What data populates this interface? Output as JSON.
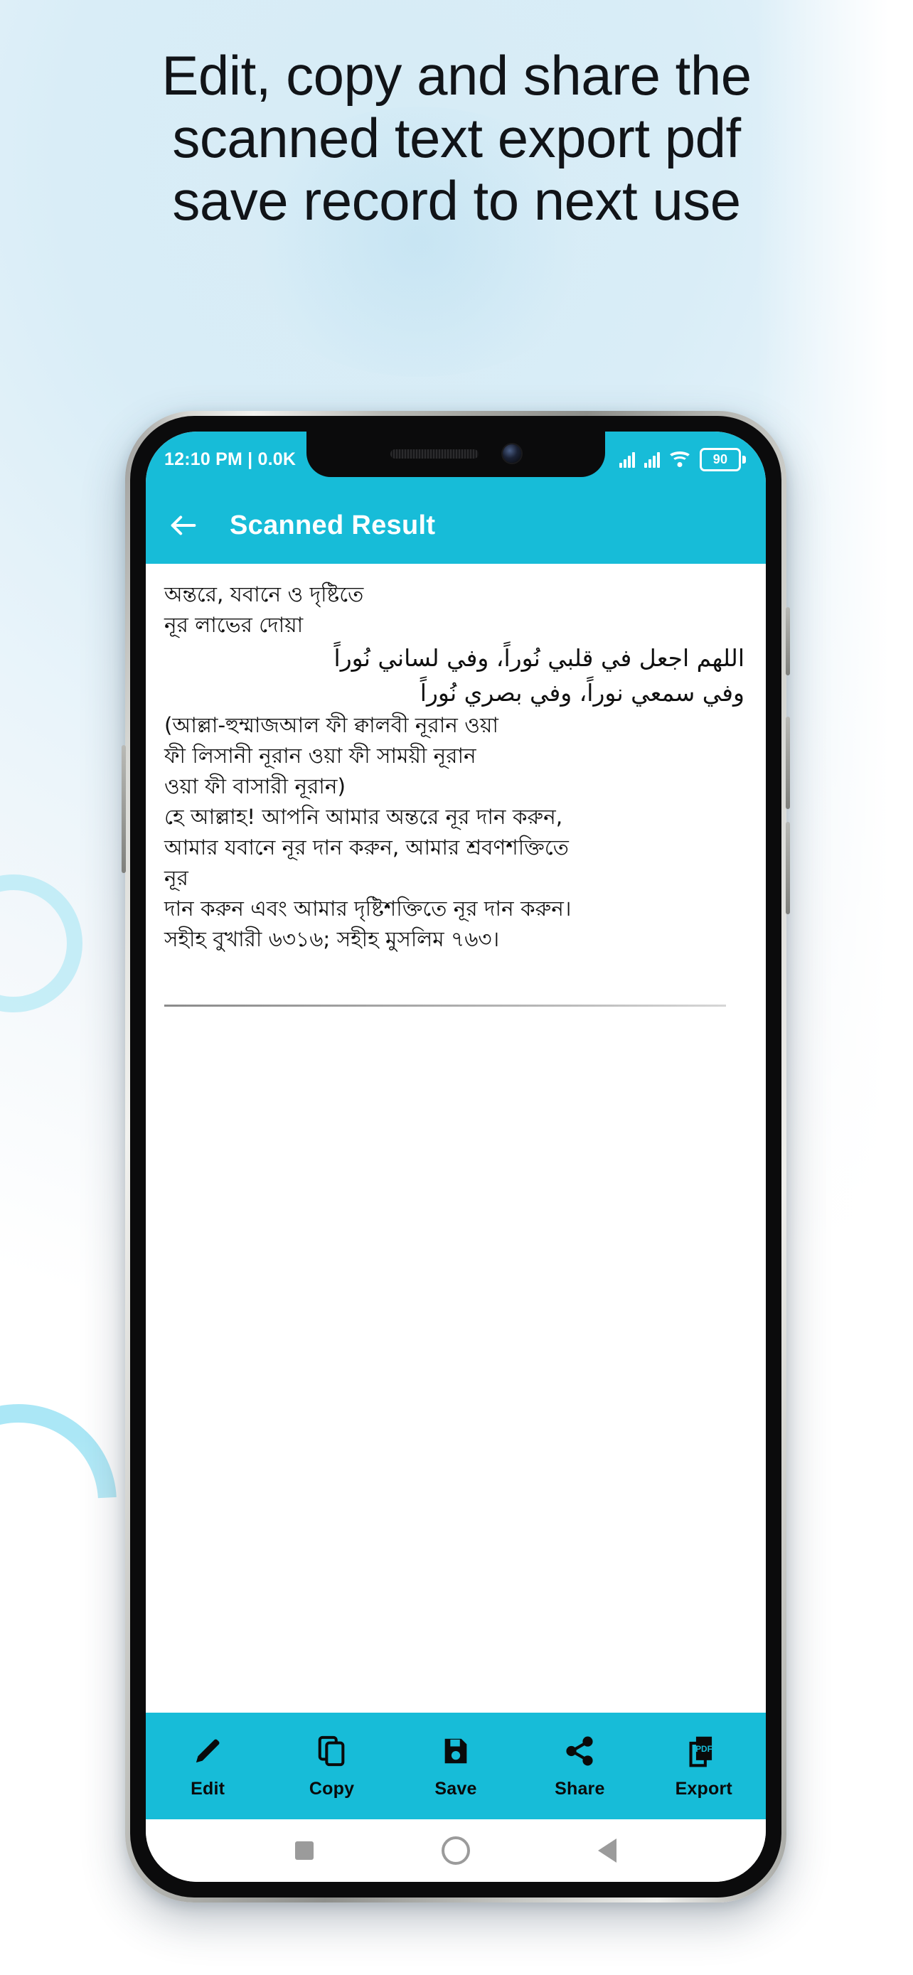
{
  "headline": {
    "lines": [
      "Edit, copy and share the",
      "scanned text export pdf",
      "save record to next use"
    ]
  },
  "colors": {
    "accent": "#17bcd8",
    "background_top": "#d8ecf7",
    "background_bottom": "#ffffff",
    "headline_text": "#111418",
    "decor_ring": "#8fdff2"
  },
  "phone": {
    "statusbar": {
      "time_and_rate": "12:10 PM | 0.0K",
      "battery_level": "90",
      "icons": [
        "signal-bars-icon",
        "signal-bars-icon",
        "wifi-icon",
        "battery-icon"
      ]
    },
    "appbar": {
      "back_icon": "arrow-left-icon",
      "title": "Scanned Result"
    },
    "document": {
      "lines": [
        {
          "dir": "ltr",
          "text": "অন্তরে, যবানে ও দৃষ্টিতে"
        },
        {
          "dir": "ltr",
          "text": "নূর লাভের দোয়া"
        },
        {
          "dir": "rtl",
          "text": "اللهم اجعل في قلبي نُوراً، وفي لساني نُوراً"
        },
        {
          "dir": "rtl",
          "text": "وفي سمعي نوراً، وفي بصري نُوراً"
        },
        {
          "dir": "ltr",
          "text": "(আল্লা-হুম্মাজআল ফী ক্বালবী নূরান ওয়া"
        },
        {
          "dir": "ltr",
          "text": "ফী লিসানী নূরান ওয়া ফী সাময়ী নূরান"
        },
        {
          "dir": "ltr",
          "text": "ওয়া ফী বাসারী নূরান)"
        },
        {
          "dir": "ltr",
          "text": "হে আল্লাহ! আপনি আমার অন্তরে নূর দান করুন,"
        },
        {
          "dir": "ltr",
          "text": "আমার যবানে নূর দান করুন, আমার শ্রবণশক্তিতে"
        },
        {
          "dir": "ltr",
          "text": "নূর"
        },
        {
          "dir": "ltr",
          "text": "দান করুন এবং আমার দৃষ্টিশক্তিতে নূর দান করুন।"
        },
        {
          "dir": "ltr",
          "text": "সহীহ বুখারী ৬৩১৬; সহীহ মুসলিম ৭৬৩।"
        }
      ]
    },
    "toolbar": {
      "items": [
        {
          "label": "Edit",
          "icon": "pencil-icon"
        },
        {
          "label": "Copy",
          "icon": "copy-icon"
        },
        {
          "label": "Save",
          "icon": "floppy-disk-icon"
        },
        {
          "label": "Share",
          "icon": "share-nodes-icon"
        },
        {
          "label": "Export",
          "icon": "pdf-file-icon"
        }
      ]
    },
    "navbar": {
      "items": [
        "recents-square-icon",
        "home-circle-icon",
        "back-triangle-icon"
      ]
    }
  }
}
